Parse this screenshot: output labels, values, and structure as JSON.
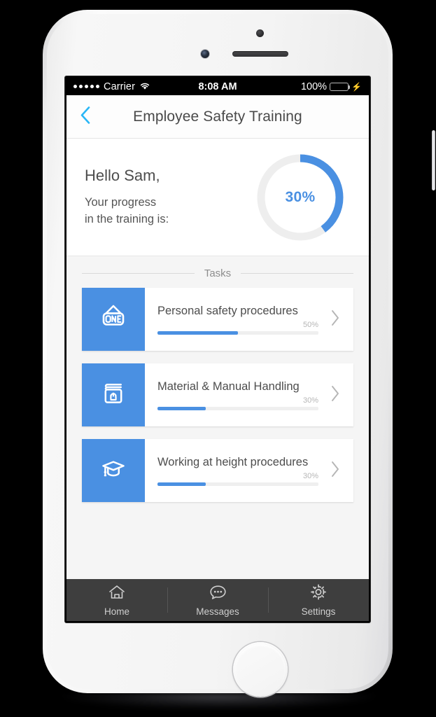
{
  "status_bar": {
    "signal_dots": 5,
    "carrier": "Carrier",
    "wifi_icon": "wifi-icon",
    "time": "8:08 AM",
    "battery_percent": "100%",
    "battery_level": 100,
    "charging_icon": "lightning-bolt-icon"
  },
  "nav": {
    "back_icon": "chevron-left-icon",
    "title": "Employee Safety Training"
  },
  "hero": {
    "greeting": "Hello Sam,",
    "subtitle_line1": "Your progress",
    "subtitle_line2": "in the training is:",
    "progress_label": "30%",
    "progress_value": 30,
    "arc_sweep_percent": 40,
    "ring_track_color": "#eeeeee",
    "ring_fill_color": "#4a90e2"
  },
  "tasks": {
    "section_label": "Tasks",
    "chevron_icon": "chevron-right-icon",
    "accent_color": "#4a90e2",
    "items": [
      {
        "icon": "open-sign-icon",
        "title": "Personal safety procedures",
        "percent_label": "50%",
        "percent_value": 50
      },
      {
        "icon": "book-hand-icon",
        "title": "Material & Manual Handling",
        "percent_label": "30%",
        "percent_value": 30
      },
      {
        "icon": "graduation-cap-icon",
        "title": "Working at height procedures",
        "percent_label": "30%",
        "percent_value": 30
      }
    ]
  },
  "tabbar": {
    "items": [
      {
        "icon": "home-icon",
        "label": "Home"
      },
      {
        "icon": "messages-bubble-icon",
        "label": "Messages"
      },
      {
        "icon": "gear-icon",
        "label": "Settings"
      }
    ]
  }
}
